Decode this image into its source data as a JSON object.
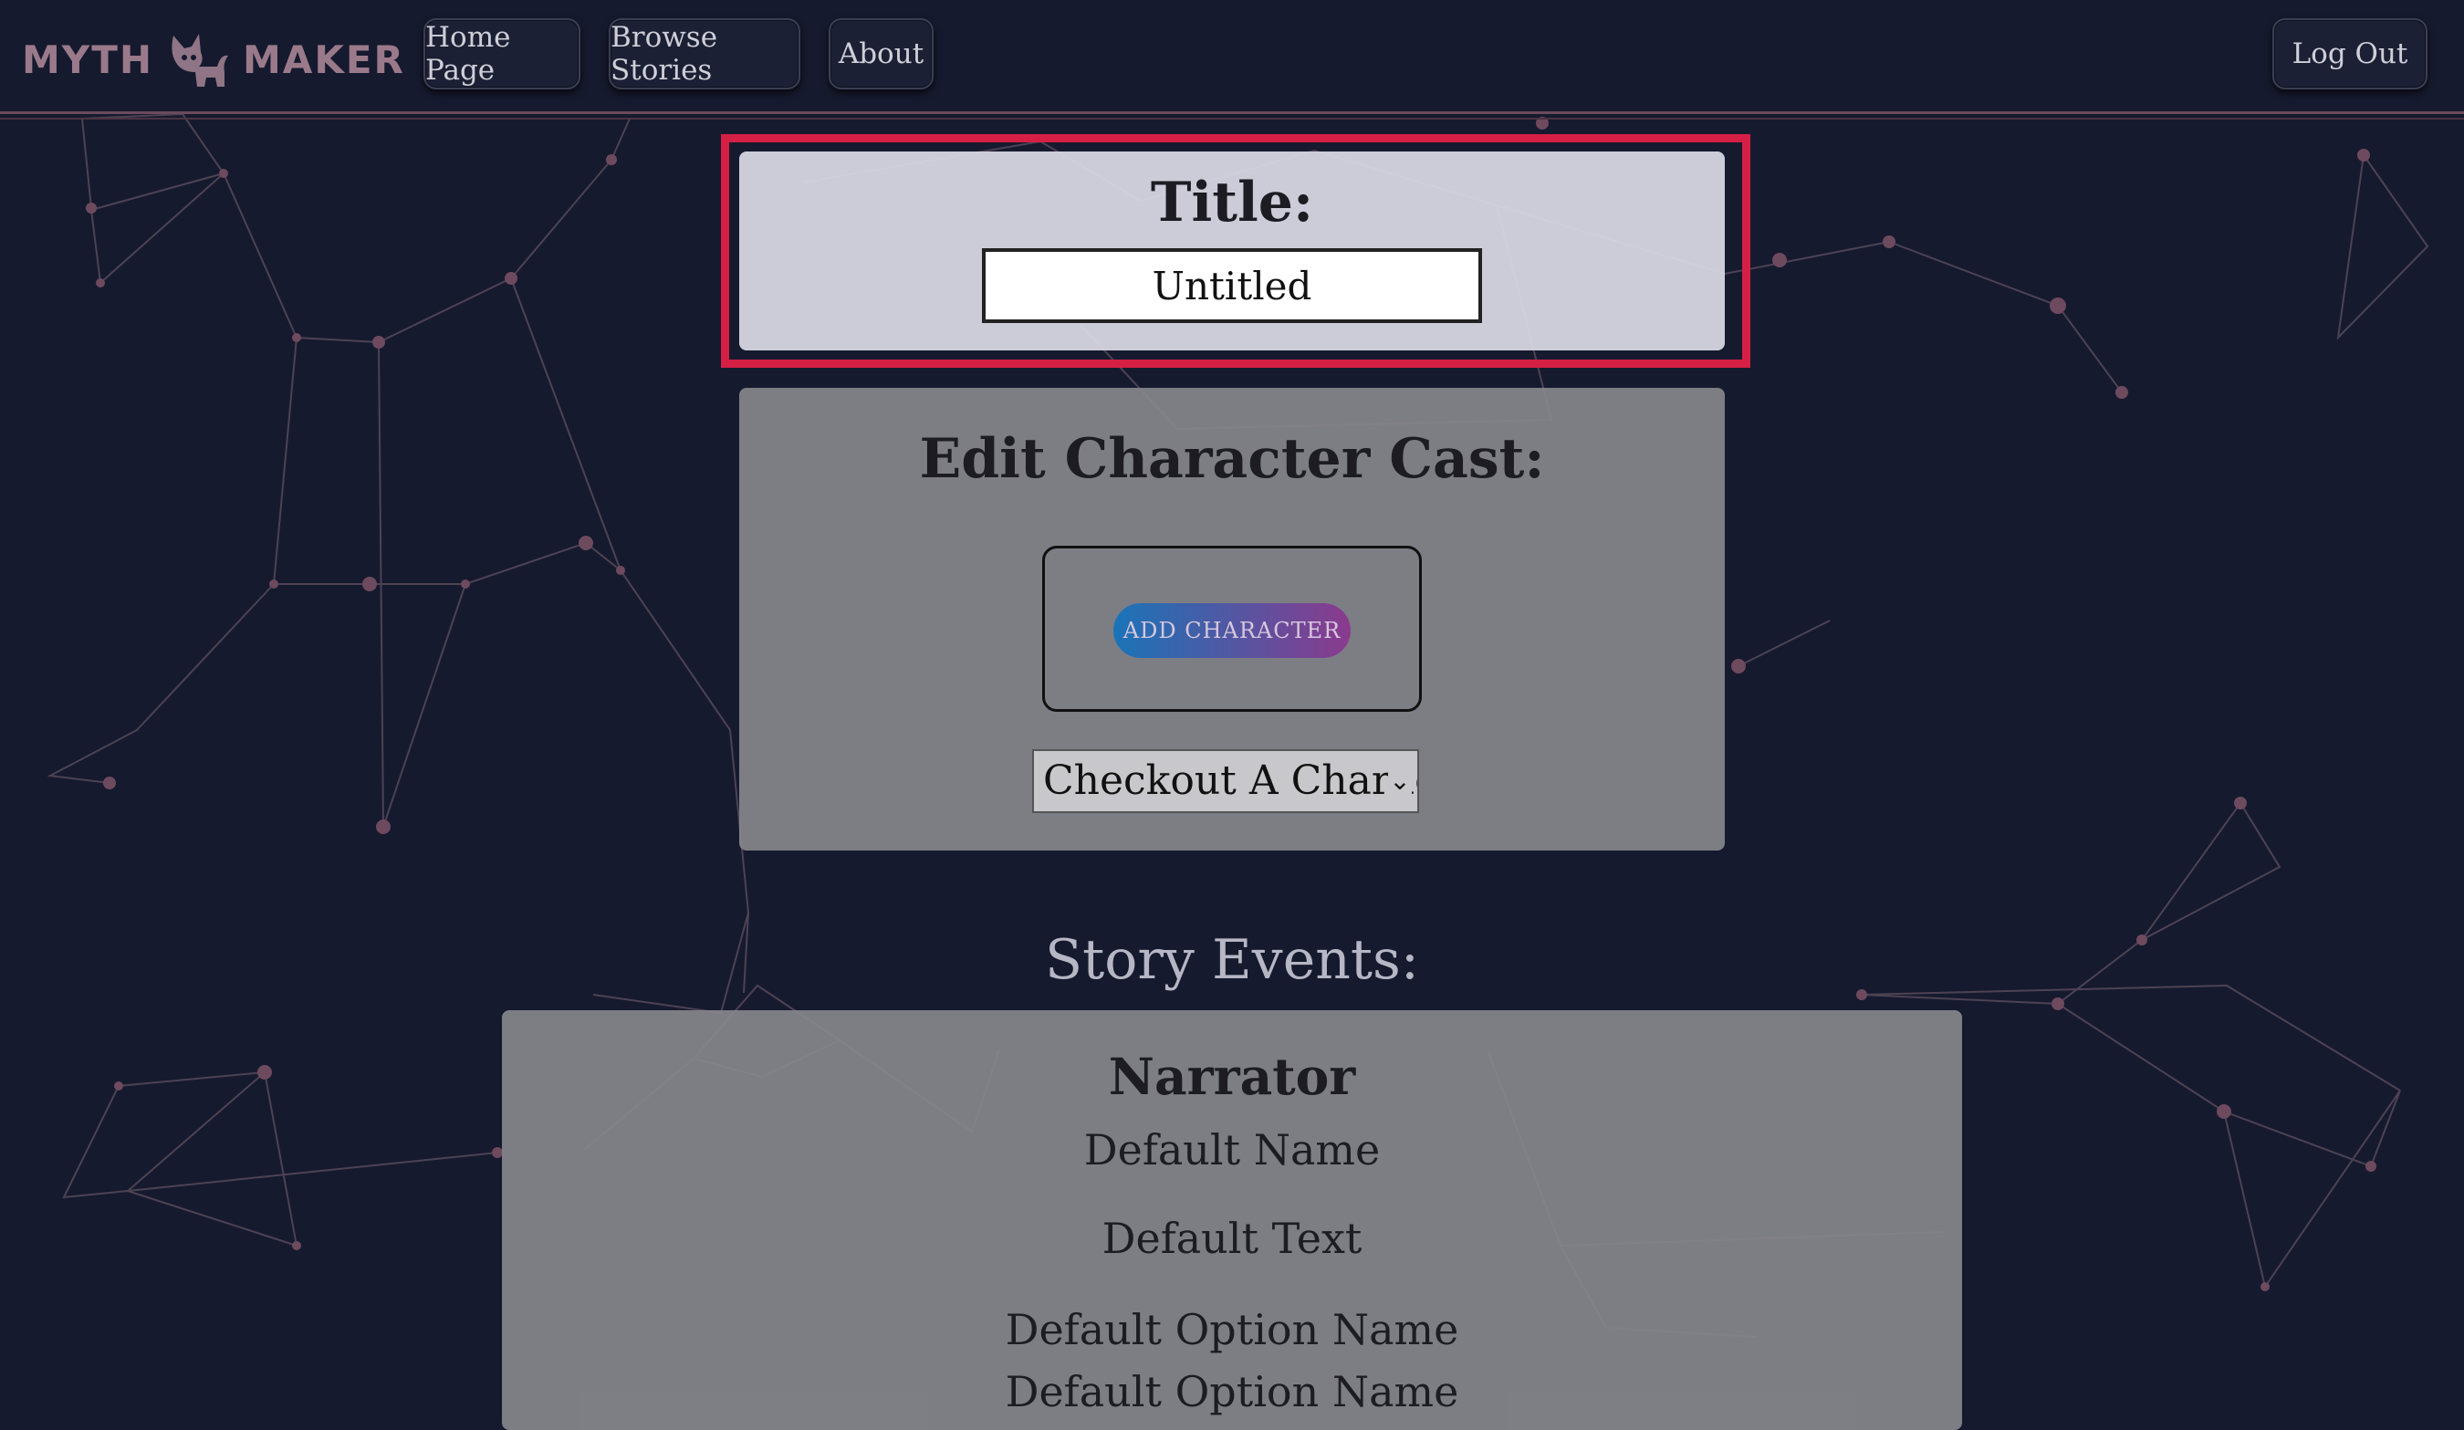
{
  "nav": {
    "brand_left": "MYTH",
    "brand_right": "MAKER",
    "brand_icon": "cat-icon",
    "buttons": [
      "Home Page",
      "Browse Stories",
      "About"
    ],
    "logout": "Log Out"
  },
  "title_section": {
    "heading": "Title:",
    "value": "Untitled"
  },
  "cast_section": {
    "heading": "Edit Character Cast:",
    "add_button": "ADD CHARACTER",
    "select_value": "Checkout A Character"
  },
  "events": {
    "heading": "Story Events:",
    "speaker": "Narrator",
    "name": "Default Name",
    "text": "Default Text",
    "options": [
      "Default Option Name",
      "Default Option Name"
    ]
  },
  "colors": {
    "background": "#161a2e",
    "highlight": "#d61f45",
    "button_gradient_start": "#1a74b8",
    "button_gradient_end": "#8b3a8e"
  }
}
